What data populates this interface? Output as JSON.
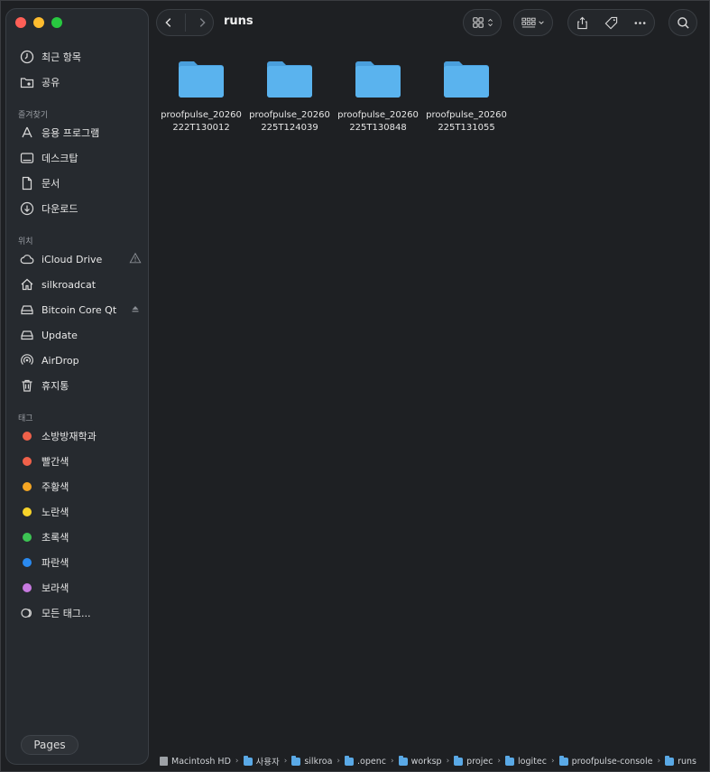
{
  "window": {
    "title": "runs"
  },
  "sidebar": {
    "top_items": [
      {
        "label": "최근 항목",
        "icon": "clock-icon"
      },
      {
        "label": "공유",
        "icon": "shared-folder-icon"
      }
    ],
    "favorites_title": "즐겨찾기",
    "favorites": [
      {
        "label": "응용 프로그램",
        "icon": "applications-icon"
      },
      {
        "label": "데스크탑",
        "icon": "desktop-icon"
      },
      {
        "label": "문서",
        "icon": "document-icon"
      },
      {
        "label": "다운로드",
        "icon": "download-icon"
      }
    ],
    "locations_title": "위치",
    "locations": [
      {
        "label": "iCloud Drive",
        "icon": "cloud-icon"
      },
      {
        "label": "silkroadcat",
        "icon": "home-icon"
      },
      {
        "label": "Bitcoin Core Qt",
        "icon": "drive-icon"
      },
      {
        "label": "Update",
        "icon": "drive-icon"
      },
      {
        "label": "AirDrop",
        "icon": "airdrop-icon"
      },
      {
        "label": "휴지통",
        "icon": "trash-icon"
      }
    ],
    "tags_title": "태그",
    "tags": [
      {
        "label": "소방방재학과",
        "color": "#f0614a"
      },
      {
        "label": "빨간색",
        "color": "#f0614a"
      },
      {
        "label": "주황색",
        "color": "#f5a623"
      },
      {
        "label": "노란색",
        "color": "#f7d32a"
      },
      {
        "label": "초록색",
        "color": "#3cc453"
      },
      {
        "label": "파란색",
        "color": "#2a8af0"
      },
      {
        "label": "보라색",
        "color": "#c77ae0"
      }
    ],
    "all_tags_label": "모든 태그...",
    "pages_label": "Pages"
  },
  "files": [
    {
      "name": "proofpulse_20260222T130012"
    },
    {
      "name": "proofpulse_20260225T124039"
    },
    {
      "name": "proofpulse_20260225T130848"
    },
    {
      "name": "proofpulse_20260225T131055"
    }
  ],
  "pathbar": [
    {
      "label": "Macintosh HD",
      "icon": "disk-icon"
    },
    {
      "label": "사용자",
      "icon": "folder-icon"
    },
    {
      "label": "silkroa",
      "icon": "folder-icon"
    },
    {
      "label": ".openc",
      "icon": "folder-icon"
    },
    {
      "label": "worksp",
      "icon": "folder-icon"
    },
    {
      "label": "projec",
      "icon": "folder-icon"
    },
    {
      "label": "logitec",
      "icon": "folder-icon"
    },
    {
      "label": "proofpulse-console",
      "icon": "folder-icon"
    },
    {
      "label": "runs",
      "icon": "folder-icon"
    }
  ],
  "colors": {
    "folder": "#5ab3ee",
    "folder_top": "#4a9fdc"
  }
}
